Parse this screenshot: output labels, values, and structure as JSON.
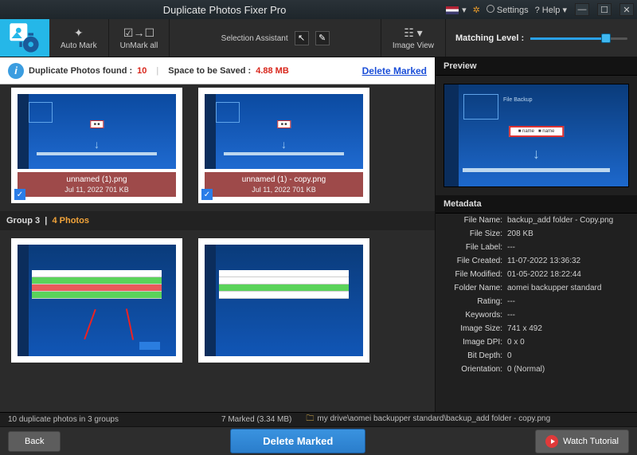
{
  "app": {
    "title": "Duplicate Photos Fixer Pro"
  },
  "titlebar": {
    "settings": "Settings",
    "help": "? Help"
  },
  "toolbar": {
    "auto_mark": "Auto Mark",
    "unmark_all": "UnMark all",
    "selection_assistant": "Selection Assistant",
    "image_view": "Image View",
    "matching_level": "Matching Level :"
  },
  "infobar": {
    "dup_label": "Duplicate Photos found :",
    "dup_count": "10",
    "space_label": "Space to be Saved :",
    "space_value": "4.88 MB",
    "delete_marked": "Delete Marked"
  },
  "groups": {
    "g2": {
      "items": [
        {
          "name": "unnamed (1).png",
          "meta": "Jul 11, 2022   701 KB",
          "checked": true
        },
        {
          "name": "unnamed (1) - copy.png",
          "meta": "Jul 11, 2022   701 KB",
          "checked": true
        }
      ]
    },
    "g3": {
      "header_prefix": "Group 3",
      "header_count": "4 Photos"
    }
  },
  "preview": {
    "title": "Preview"
  },
  "metadata": {
    "title": "Metadata",
    "rows": [
      {
        "k": "File Name:",
        "v": "backup_add folder - Copy.png"
      },
      {
        "k": "File Size:",
        "v": "208 KB"
      },
      {
        "k": "File Label:",
        "v": "---"
      },
      {
        "k": "File Created:",
        "v": "11-07-2022 13:36:32"
      },
      {
        "k": "File Modified:",
        "v": "01-05-2022 18:22:44"
      },
      {
        "k": "Folder Name:",
        "v": "aomei backupper standard"
      },
      {
        "k": "Rating:",
        "v": "---"
      },
      {
        "k": "Keywords:",
        "v": "---"
      },
      {
        "k": "Image Size:",
        "v": "741 x 492"
      },
      {
        "k": "Image DPI:",
        "v": "0 x 0"
      },
      {
        "k": "Bit Depth:",
        "v": "0"
      },
      {
        "k": "Orientation:",
        "v": "0 (Normal)"
      }
    ]
  },
  "status": {
    "summary": "10 duplicate photos in 3 groups",
    "marked": "7 Marked (3.34 MB)",
    "path": "my drive\\aomei backupper standard\\backup_add folder - copy.png"
  },
  "bottom": {
    "back": "Back",
    "delete_marked": "Delete Marked",
    "watch": "Watch Tutorial"
  }
}
